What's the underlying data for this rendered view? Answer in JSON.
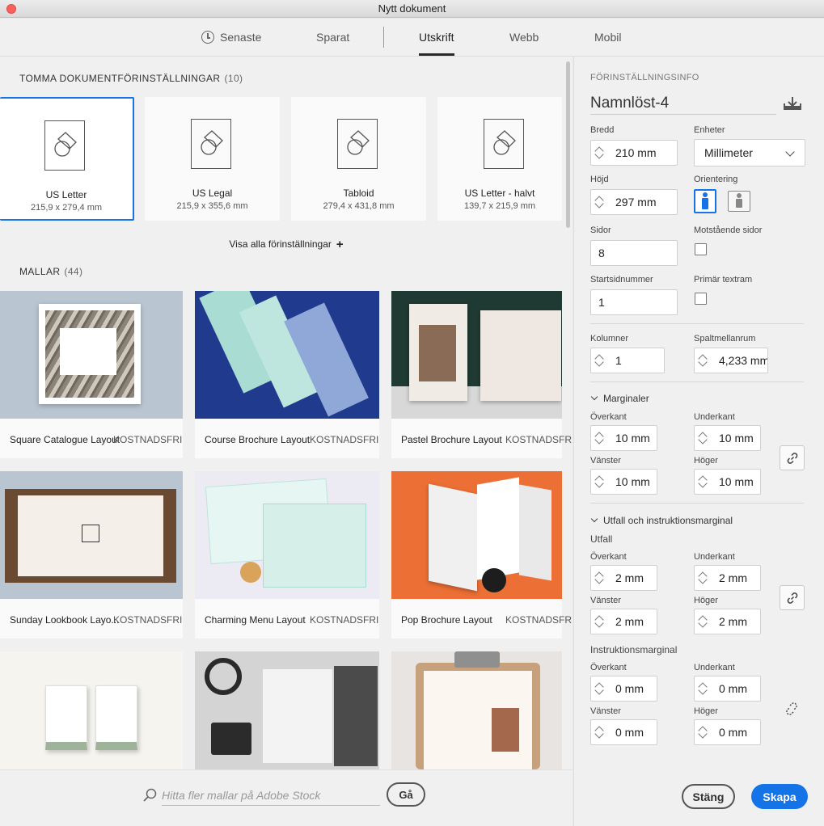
{
  "window": {
    "title": "Nytt dokument"
  },
  "tabs": [
    {
      "label": "Senaste",
      "icon": "clock-icon"
    },
    {
      "label": "Sparat"
    },
    {
      "label": "Utskrift",
      "active": true
    },
    {
      "label": "Webb"
    },
    {
      "label": "Mobil"
    }
  ],
  "presets_section": {
    "title": "TOMMA DOKUMENTFÖRINSTÄLLNINGAR",
    "count": "(10)"
  },
  "presets": [
    {
      "name": "US Letter",
      "size": "215,9 x 279,4 mm",
      "selected": true
    },
    {
      "name": "US Legal",
      "size": "215,9 x 355,6 mm"
    },
    {
      "name": "Tabloid",
      "size": "279,4 x 431,8 mm"
    },
    {
      "name": "US Letter - halvt",
      "size": "139,7 x 215,9 mm"
    }
  ],
  "view_all": {
    "label": "Visa alla förinställningar",
    "icon": "+"
  },
  "templates_section": {
    "title": "MALLAR",
    "count": "(44)"
  },
  "templates": [
    {
      "name": "Square Catalogue Layout",
      "price": "KOSTNADSFRI"
    },
    {
      "name": "Course Brochure Layout",
      "price": "KOSTNADSFRI"
    },
    {
      "name": "Pastel Brochure Layout",
      "price": "KOSTNADSFRI"
    },
    {
      "name": "Sunday Lookbook Layo...",
      "price": "KOSTNADSFRI"
    },
    {
      "name": "Charming Menu Layout",
      "price": "KOSTNADSFRI"
    },
    {
      "name": "Pop Brochure Layout",
      "price": "KOSTNADSFRI"
    }
  ],
  "search": {
    "placeholder": "Hitta fler mallar på Adobe Stock",
    "go_label": "Gå"
  },
  "info": {
    "heading": "FÖRINSTÄLLNINGSINFO",
    "doc_name": "Namnlöst-4",
    "width_label": "Bredd",
    "width": "210 mm",
    "units_label": "Enheter",
    "units": "Millimeter",
    "height_label": "Höjd",
    "height": "297 mm",
    "orientation_label": "Orientering",
    "pages_label": "Sidor",
    "pages": "8",
    "facing_label": "Motstående sidor",
    "start_label": "Startsidnummer",
    "start": "1",
    "primary_label": "Primär textram",
    "columns_label": "Kolumner",
    "columns": "1",
    "gutter_label": "Spaltmellanrum",
    "gutter": "4,233 mm"
  },
  "margins": {
    "title": "Marginaler",
    "top_label": "Överkant",
    "top": "10 mm",
    "bottom_label": "Underkant",
    "bottom": "10 mm",
    "left_label": "Vänster",
    "left": "10 mm",
    "right_label": "Höger",
    "right": "10 mm"
  },
  "bleed": {
    "title": "Utfall och instruktionsmarginal",
    "bleed_label": "Utfall",
    "top_label": "Överkant",
    "top": "2 mm",
    "bottom_label": "Underkant",
    "bottom": "2 mm",
    "left_label": "Vänster",
    "left": "2 mm",
    "right_label": "Höger",
    "right": "2 mm",
    "slug_label": "Instruktionsmarginal",
    "s_top_label": "Överkant",
    "s_top": "0 mm",
    "s_bottom_label": "Underkant",
    "s_bottom": "0 mm",
    "s_left_label": "Vänster",
    "s_left": "0 mm",
    "s_right_label": "Höger",
    "s_right": "0 mm"
  },
  "buttons": {
    "close": "Stäng",
    "create": "Skapa"
  },
  "colors": {
    "accent": "#1473e6"
  }
}
